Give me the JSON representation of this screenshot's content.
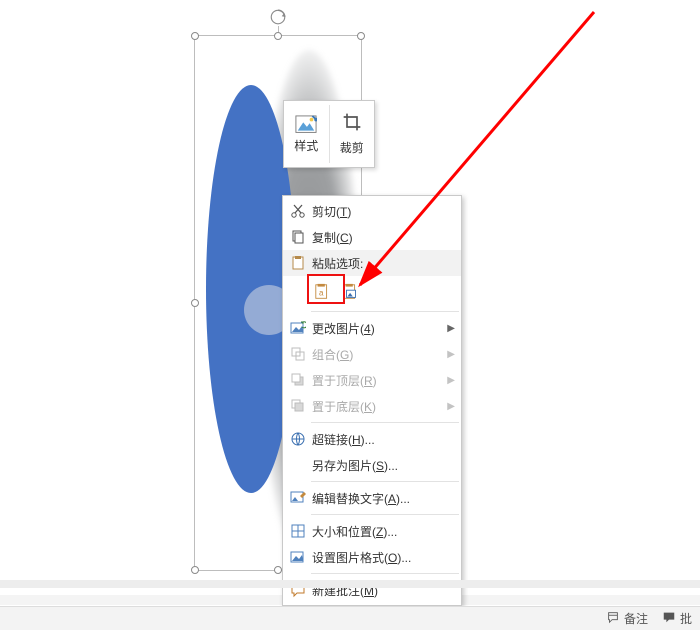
{
  "mini_toolbar": {
    "style": "样式",
    "crop": "裁剪"
  },
  "menu": {
    "cut": {
      "label": "剪切(",
      "key": "T",
      "suffix": ")"
    },
    "copy": {
      "label": "复制(",
      "key": "C",
      "suffix": ")"
    },
    "paste_options": {
      "label": "粘贴选项:"
    },
    "change_pic": {
      "label": "更改图片(",
      "key": "4",
      "suffix": ")"
    },
    "group": {
      "label": "组合(",
      "key": "G",
      "suffix": ")"
    },
    "bring_front": {
      "label": "置于顶层(",
      "key": "R",
      "suffix": ")"
    },
    "send_back": {
      "label": "置于底层(",
      "key": "K",
      "suffix": ")"
    },
    "hyperlink": {
      "label": "超链接(",
      "key": "H",
      "suffix": ")..."
    },
    "save_as_pic": {
      "label": "另存为图片(",
      "key": "S",
      "suffix": ")..."
    },
    "alt_text": {
      "label": "编辑替换文字(",
      "key": "A",
      "suffix": ")..."
    },
    "size_pos": {
      "label": "大小和位置(",
      "key": "Z",
      "suffix": ")..."
    },
    "format_pic": {
      "label": "设置图片格式(",
      "key": "O",
      "suffix": ")..."
    },
    "new_comment": {
      "label": "新建批注(",
      "key": "M",
      "suffix": ")"
    }
  },
  "status": {
    "notes": "备注",
    "comments": "批"
  },
  "colors": {
    "arrow": "#ff0000",
    "highlight_box": "#e11",
    "shape_fill": "#4472c4"
  }
}
